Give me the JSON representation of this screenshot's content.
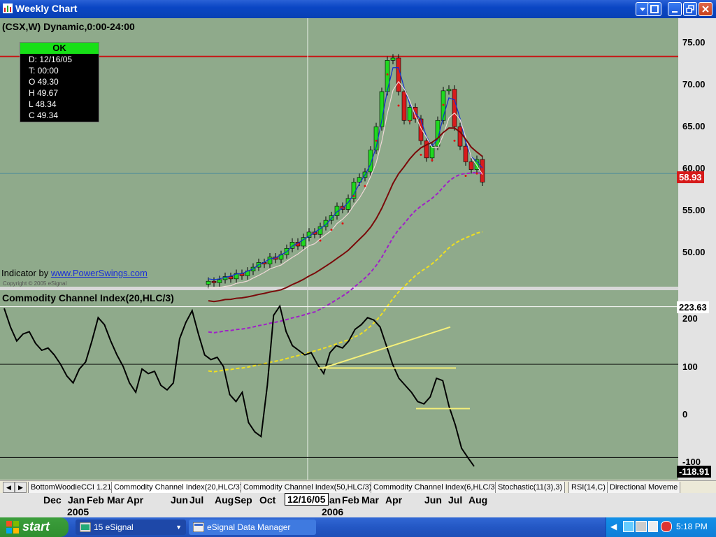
{
  "window": {
    "title": "Weekly Chart"
  },
  "chart": {
    "symbol_line": "(CSX,W) Dynamic,0:00-24:00",
    "ohlc_box": {
      "status": "OK",
      "date": "D: 12/16/05",
      "time": "T: 00:00",
      "open": "O 49.30",
      "high": "H 49.67",
      "low": "L 48.34",
      "close": "C 49.34"
    },
    "indicator_by": "Indicator by",
    "indicator_link": "www.PowerSwings.com",
    "copyright": "Copyright © 2005 eSignal",
    "price_axis": [
      "75.00",
      "70.00",
      "65.00",
      "60.00",
      "55.00",
      "50.00"
    ],
    "price_badge": "58.93",
    "cci_title": "Commodity Channel Index(20,HLC/3)",
    "cci_axis": [
      "200",
      "100",
      "0",
      "-100"
    ],
    "cci_top_badge": "223.63",
    "cci_badge": "-118.91"
  },
  "tabs": [
    "BottomWoodieCCI 1.21",
    "Commodity Channel Index(20,HLC/3)",
    "Commodity Channel Index(50,HLC/3)",
    "Commodity Channel Index(6,HLC/3)",
    "Stochastic(11(3),3)",
    "RSI(14,C)",
    "Directional Moveme"
  ],
  "x_axis": {
    "months": [
      "Dec",
      "Jan",
      "Feb",
      "Mar",
      "Apr",
      "Jun",
      "Jul",
      "Aug",
      "Sep",
      "Oct",
      "an",
      "Feb",
      "Mar",
      "Apr",
      "Jun",
      "Jul",
      "Aug"
    ],
    "years": [
      "2005",
      "2006"
    ],
    "cursor_date": "12/16/05"
  },
  "taskbar": {
    "start": "start",
    "items": [
      "15 eSignal",
      "eSignal Data Manager"
    ],
    "clock": "5:18 PM"
  },
  "colors": {
    "plot_bg": "#8faa8b",
    "up_candle": "#1fd81f",
    "down_candle": "#d81c1c",
    "resistance": "#c81414"
  },
  "chart_data": {
    "type": "candlestick",
    "title": "(CSX,W) Dynamic,0:00-24:00",
    "price_ylim": [
      45.5,
      76.5
    ],
    "close": [
      46.2,
      46.0,
      46.4,
      46.8,
      46.5,
      47.2,
      46.9,
      47.5,
      48.0,
      48.6,
      48.4,
      49.3,
      49.0,
      49.6,
      50.4,
      51.2,
      50.7,
      51.8,
      52.5,
      52.2,
      53.2,
      54.0,
      54.6,
      55.8,
      55.4,
      56.8,
      58.9,
      59.5,
      60.2,
      63.0,
      66.0,
      70.5,
      74.5,
      74.8,
      70.5,
      66.8,
      68.5,
      67.0,
      64.2,
      62.0,
      63.5,
      66.8,
      70.6,
      70.8,
      66.0,
      63.5,
      61.5,
      60.5,
      61.8,
      58.9
    ],
    "cci": [
      220,
      180,
      150,
      165,
      170,
      145,
      130,
      135,
      120,
      100,
      75,
      60,
      90,
      105,
      150,
      200,
      185,
      150,
      120,
      95,
      60,
      40,
      90,
      80,
      85,
      55,
      45,
      60,
      155,
      190,
      215,
      165,
      120,
      110,
      115,
      95,
      35,
      20,
      40,
      -25,
      -45,
      -55,
      55,
      205,
      225,
      170,
      140,
      130,
      120,
      125,
      100,
      80,
      125,
      140,
      135,
      150,
      175,
      185,
      200,
      195,
      180,
      140,
      100,
      70,
      55,
      40,
      20,
      15,
      30,
      70,
      65,
      10,
      -30,
      -80,
      -100,
      -118.9
    ],
    "cci_ylim": [
      -125,
      235
    ]
  }
}
